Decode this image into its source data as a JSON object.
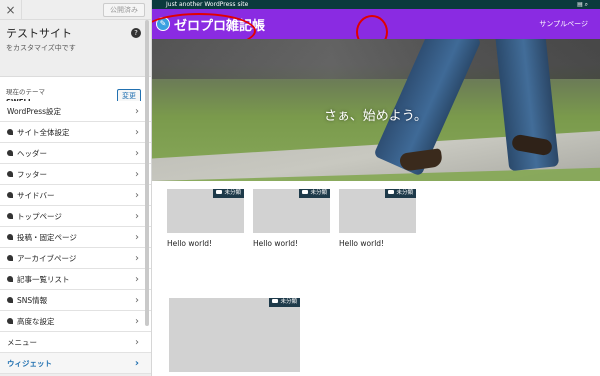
{
  "sidebar": {
    "close_icon": "×",
    "publish_label": "公開済み",
    "site_title": "テストサイト",
    "site_sub": "をカスタマイズ中です",
    "help_icon": "?",
    "theme_label": "現在のテーマ",
    "theme_name": "SWELL",
    "theme_change": "変更",
    "items": [
      {
        "label": "WordPress設定",
        "icon": false
      },
      {
        "label": "サイト全体設定",
        "icon": true
      },
      {
        "label": "ヘッダー",
        "icon": true
      },
      {
        "label": "フッター",
        "icon": true
      },
      {
        "label": "サイドバー",
        "icon": true
      },
      {
        "label": "トップページ",
        "icon": true
      },
      {
        "label": "投稿・固定ページ",
        "icon": true
      },
      {
        "label": "アーカイブページ",
        "icon": true
      },
      {
        "label": "記事一覧リスト",
        "icon": true
      },
      {
        "label": "SNS情報",
        "icon": true
      },
      {
        "label": "高度な設定",
        "icon": true
      },
      {
        "label": "メニュー",
        "icon": false
      },
      {
        "label": "ウィジェット",
        "icon": false
      }
    ],
    "chevron": "›"
  },
  "preview": {
    "tagline": "Just another WordPress site",
    "top_icons": "▤  ⌕",
    "logo": "ゼロプロ雑記帳",
    "nav_sample": "サンプルページ",
    "edit_icon": "✎",
    "hero_text": "さぁ、始めよう。",
    "cards": [
      {
        "title": "Hello world!",
        "category": "未分類"
      },
      {
        "title": "Hello world!",
        "category": "未分類"
      },
      {
        "title": "Hello world!",
        "category": "未分類"
      },
      {
        "title": "",
        "category": "未分類"
      }
    ]
  },
  "colors": {
    "header_bg": "#8a2be2",
    "topbar_bg": "#0b3a3d",
    "annotation": "#e10000",
    "accent": "#2271b1"
  }
}
